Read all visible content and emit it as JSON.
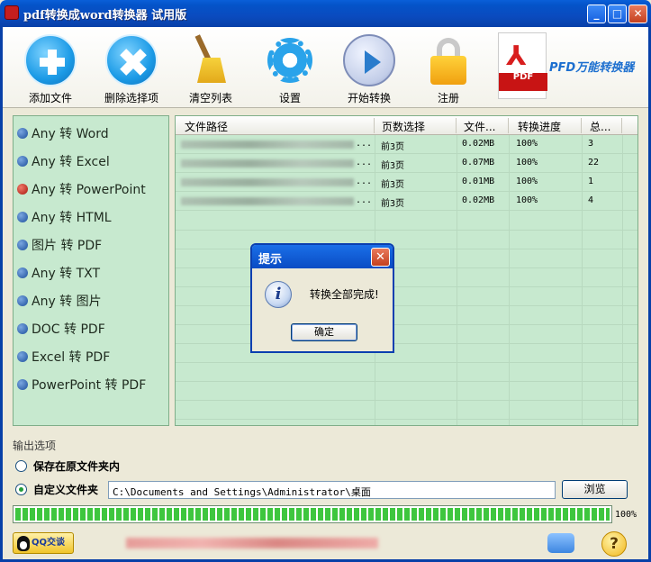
{
  "window": {
    "title": "pdf转换成word转换器 试用版",
    "min": "_",
    "max": "□",
    "close": "✕"
  },
  "toolbar": {
    "add": "添加文件",
    "remove": "删除选择项",
    "clear": "清空列表",
    "settings": "设置",
    "start": "开始转换",
    "register": "注册",
    "brand": "PFD万能转换器",
    "pdf_logo_symbol": "⅄",
    "pdf_logo_tag": "PDF"
  },
  "left_options": {
    "items": [
      {
        "label": "Any 转 Word",
        "selected": false
      },
      {
        "label": "Any 转 Excel",
        "selected": false
      },
      {
        "label": "Any 转 PowerPoint",
        "selected": true
      },
      {
        "label": "Any 转 HTML",
        "selected": false
      },
      {
        "label": "图片 转 PDF",
        "selected": false
      },
      {
        "label": "Any 转 TXT",
        "selected": false
      },
      {
        "label": "Any 转 图片",
        "selected": false
      },
      {
        "label": "DOC 转 PDF",
        "selected": false
      },
      {
        "label": "Excel 转 PDF",
        "selected": false
      },
      {
        "label": "PowerPoint 转 PDF",
        "selected": false
      }
    ]
  },
  "table": {
    "headers": {
      "path": "文件路径",
      "pages": "页数选择",
      "size": "文件...",
      "progress": "转换进度",
      "total": "总..."
    },
    "rows": [
      {
        "dots": "...",
        "pages": "前3页",
        "size": "0.02MB",
        "progress": "100%",
        "total": "3"
      },
      {
        "dots": "...",
        "pages": "前3页",
        "size": "0.07MB",
        "progress": "100%",
        "total": "22"
      },
      {
        "dots": "...",
        "pages": "前3页",
        "size": "0.01MB",
        "progress": "100%",
        "total": "1"
      },
      {
        "dots": "...",
        "pages": "前3页",
        "size": "0.02MB",
        "progress": "100%",
        "total": "4"
      }
    ]
  },
  "dialog": {
    "title": "提示",
    "close": "✕",
    "icon": "i",
    "message": "转换全部完成!",
    "ok": "确定"
  },
  "output": {
    "title": "输出选项",
    "option_original": "保存在原文件夹内",
    "option_custom": "自定义文件夹",
    "selected": "custom",
    "path": "C:\\Documents and Settings\\Administrator\\桌面",
    "browse": "浏览"
  },
  "progress": {
    "value": 1.0,
    "label": "100%"
  },
  "footer": {
    "qq": "QQ交谈",
    "help": "?"
  }
}
